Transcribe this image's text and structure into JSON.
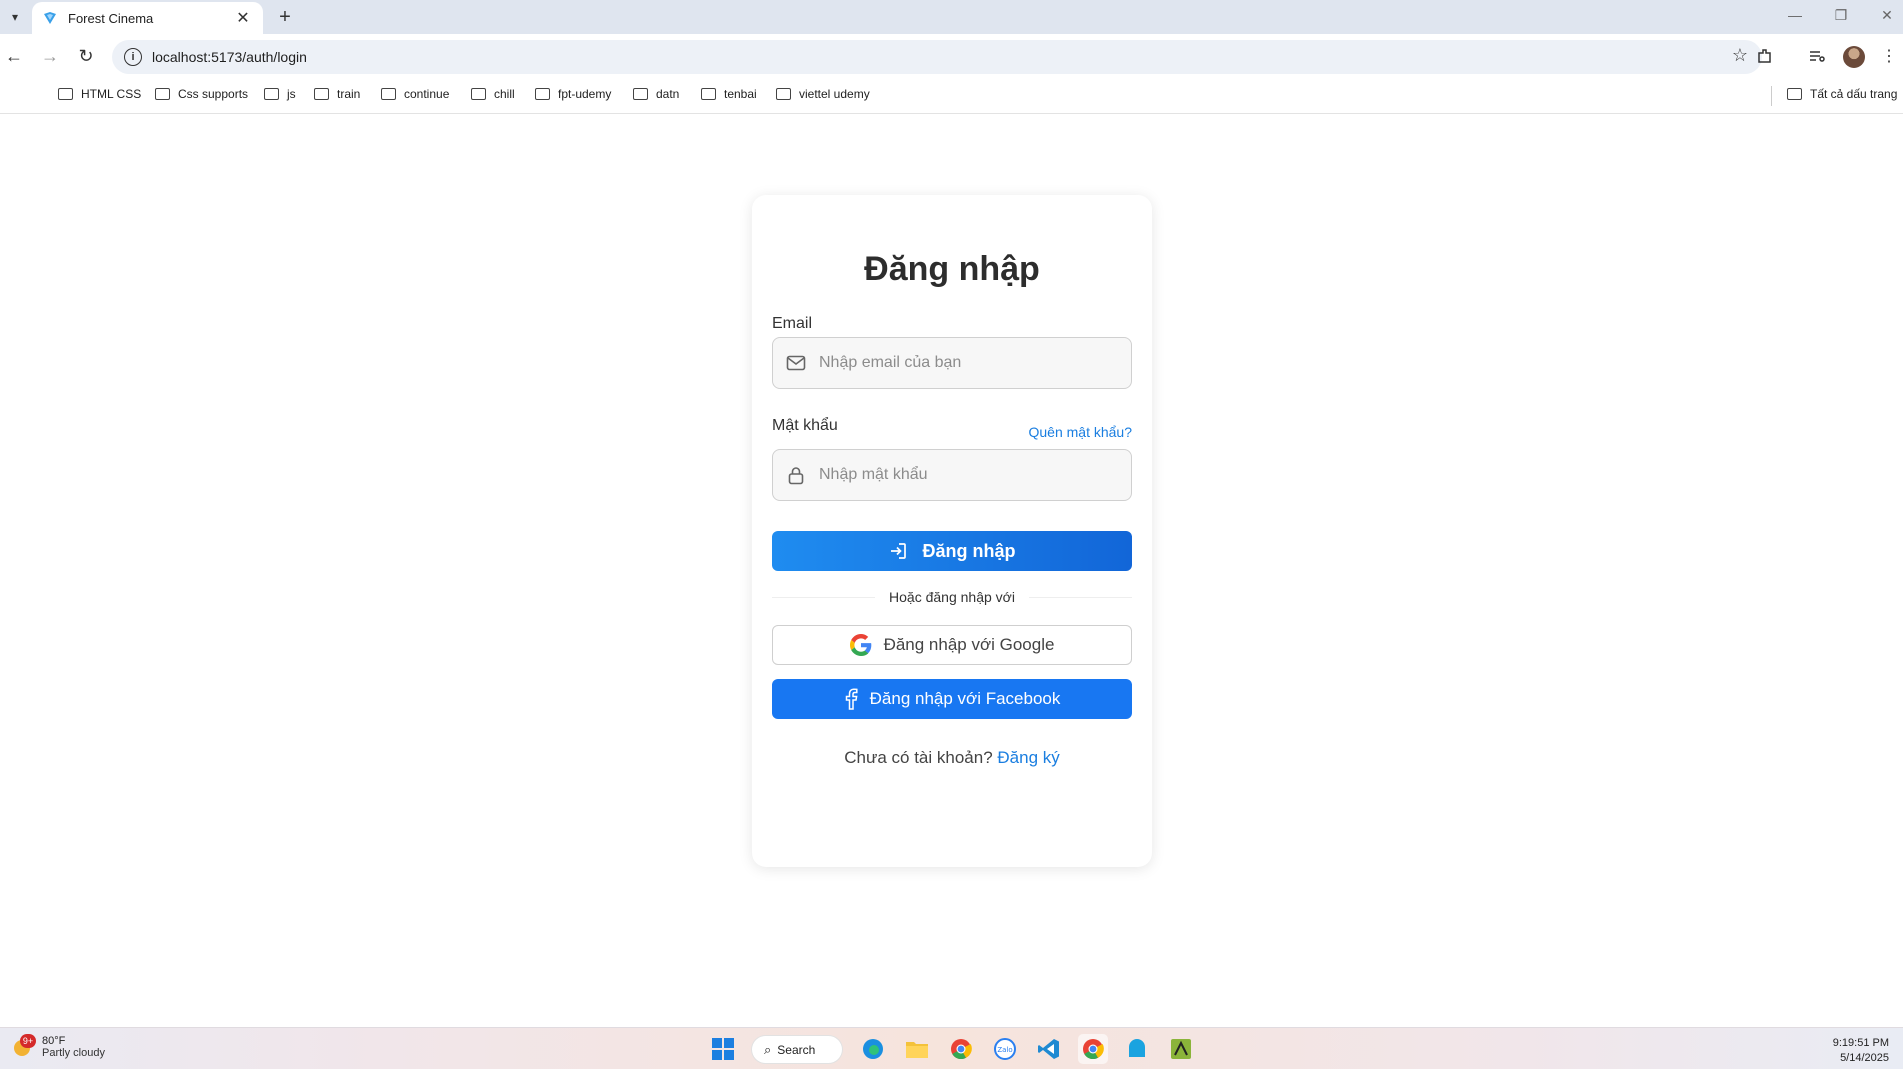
{
  "browser": {
    "tab_title": "Forest Cinema",
    "url": "localhost:5173/auth/login",
    "bookmarks": [
      "HTML CSS",
      "Css supports",
      "js",
      "train",
      "continue",
      "chill",
      "fpt-udemy",
      "datn",
      "tenbai",
      "viettel udemy"
    ],
    "all_bookmarks": "Tất cả dấu trang"
  },
  "login": {
    "title": "Đăng nhập",
    "email_label": "Email",
    "email_placeholder": "Nhập email của bạn",
    "password_label": "Mật khẩu",
    "forgot_password": "Quên mật khẩu?",
    "password_placeholder": "Nhập mật khẩu",
    "submit_label": "Đăng nhập",
    "divider_text": "Hoặc đăng nhập với",
    "google_label": "Đăng nhập với Google",
    "facebook_label": "Đăng nhập với Facebook",
    "no_account_text": "Chưa có tài khoản?",
    "signup_link": "Đăng ký"
  },
  "taskbar": {
    "weather_temp": "80°F",
    "weather_desc": "Partly cloudy",
    "weather_badge": "9+",
    "search_label": "Search",
    "time": "9:19:51 PM",
    "date": "5/14/2025"
  },
  "colors": {
    "primary": "#1a7ee0",
    "facebook": "#1877f2"
  }
}
